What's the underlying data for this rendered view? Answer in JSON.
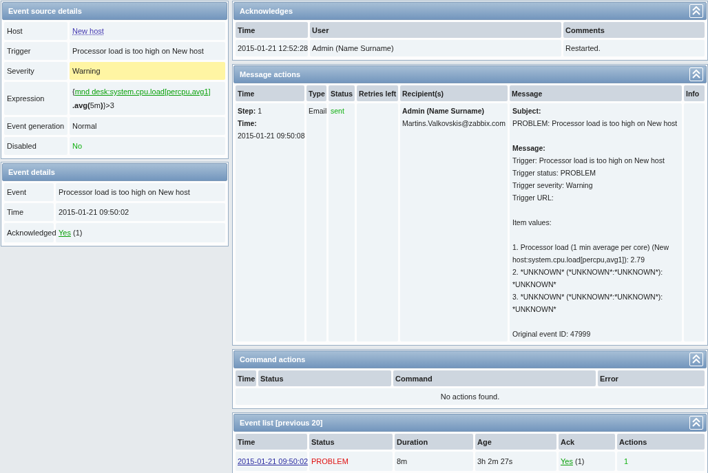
{
  "event_source_details": {
    "title": "Event source details",
    "collapsible": false,
    "rows": [
      {
        "label": "Host",
        "kind": "link",
        "value": "New host"
      },
      {
        "label": "Trigger",
        "kind": "text",
        "value": "Processor load is too high on New host"
      },
      {
        "label": "Severity",
        "kind": "severity",
        "value": "Warning"
      },
      {
        "label": "Expression",
        "kind": "parts",
        "parts": [
          {
            "kind": "text",
            "text": "{"
          },
          {
            "kind": "link",
            "text": "mnd desk:system.cpu.load[percpu,avg1]"
          },
          {
            "kind": "bold",
            "text": ".avg("
          },
          {
            "kind": "text",
            "text": "5m"
          },
          {
            "kind": "bold",
            "text": ")"
          },
          {
            "kind": "text",
            "text": "}>3"
          }
        ]
      },
      {
        "label": "Event generation",
        "kind": "text",
        "value": "Normal"
      },
      {
        "label": "Disabled",
        "kind": "ok",
        "value": "No"
      }
    ]
  },
  "event_details": {
    "title": "Event details",
    "collapsible": false,
    "rows": [
      {
        "label": "Event",
        "kind": "text",
        "value": "Processor load is too high on New host"
      },
      {
        "label": "Time",
        "kind": "text",
        "value": "2015-01-21 09:50:02"
      },
      {
        "label": "Acknowledged",
        "kind": "parts",
        "parts": [
          {
            "kind": "link",
            "text": "Yes"
          },
          {
            "kind": "text",
            "text": "(1)"
          }
        ]
      }
    ]
  },
  "acknowledges": {
    "title": "Acknowledges",
    "collapsible": true,
    "columns": [
      "Time",
      "User",
      "Comments"
    ],
    "rows": [
      {
        "cells": [
          "2015-01-21 12:52:28",
          "Admin (Name Surname)",
          "Restarted."
        ]
      }
    ]
  },
  "message_actions": {
    "title": "Message actions",
    "collapsible": true,
    "columns": [
      "Time",
      "Type",
      "Status",
      "Retries left",
      "Recipient(s)",
      "Message",
      "Info"
    ],
    "rows": [
      {
        "step": "**Step:** 1",
        "time_label": "Time:",
        "time": "2015-01-21 09:50:08",
        "type": "Email",
        "status": "sent",
        "problem": false,
        "recipient_name": "Admin (Name Surname)",
        "recipient_address": "Martins.Valkovskis@zabbix.com",
        "message": {
          "subject_label": "Subject:",
          "subject": "PROBLEM: Processor load is too high on New host",
          "message_label": "Message:",
          "blocks": [
            [
              "Trigger: Processor load is too high on New host",
              "Trigger status: PROBLEM",
              "Trigger severity: Warning",
              "Trigger URL:"
            ],
            [
              "Item values:"
            ],
            [
              "1. Processor load (1 min average per core) (New host:system.cpu.load[percpu,avg1]): 2.79",
              "2. *UNKNOWN* (*UNKNOWN*:*UNKNOWN*): *UNKNOWN*",
              "3. *UNKNOWN* (*UNKNOWN*:*UNKNOWN*): *UNKNOWN*"
            ],
            [
              "Original event ID: 47999"
            ]
          ]
        }
      }
    ]
  },
  "command_actions": {
    "title": "Command actions",
    "collapsible": true,
    "columns": [
      "Time",
      "Status",
      "Command",
      "Error"
    ],
    "empty_message": "No actions found."
  },
  "event_list": {
    "title": "Event list [previous 20]",
    "collapsible": true,
    "columns": [
      "Time",
      "Status",
      "Duration",
      "Age",
      "Ack",
      "Actions"
    ],
    "rows": [
      {
        "time": "2015-01-21 09:50:02",
        "status": "PROBLEM",
        "problem": true,
        "duration": "8m",
        "age": "3h 2m 27s",
        "ack": "Yes",
        "ack_count": "(1)",
        "actions": "1"
      }
    ]
  }
}
